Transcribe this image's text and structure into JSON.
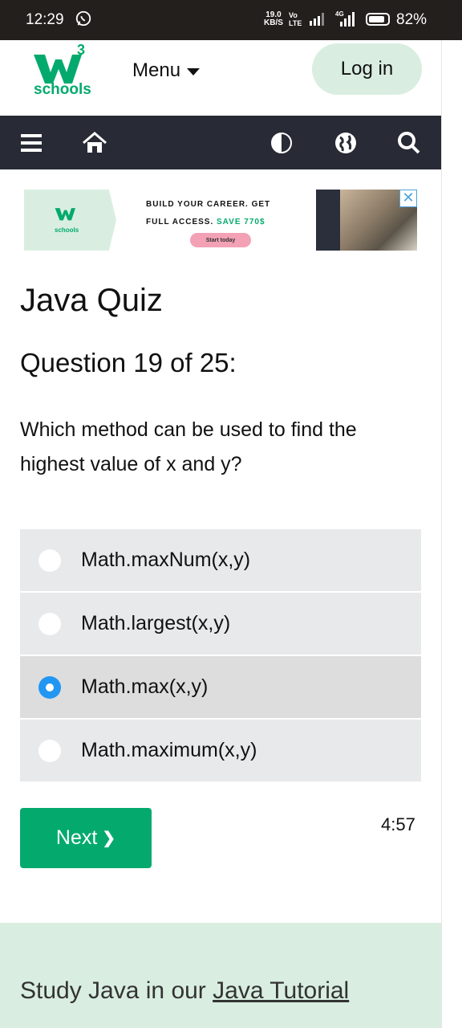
{
  "status_bar": {
    "time": "12:29",
    "net_speed_value": "19.0",
    "net_speed_unit": "KB/S",
    "volte_top": "Vo",
    "volte_bottom": "LTE",
    "network": "4G",
    "battery": "82%"
  },
  "header": {
    "logo_superscript": "3",
    "logo_text": "schools",
    "menu_label": "Menu",
    "login_label": "Log in"
  },
  "navbar": {
    "icons": [
      "menu-icon",
      "home-icon",
      "contrast-icon",
      "globe-icon",
      "search-icon"
    ]
  },
  "ad": {
    "logo_text": "schools",
    "line1": "BUILD YOUR CAREER. GET",
    "line2_prefix": "FULL ACCESS.",
    "line2_accent": "SAVE 770$",
    "cta": "Start today",
    "close": "✕"
  },
  "quiz": {
    "title": "Java Quiz",
    "question_count": "Question 19 of 25:",
    "question_text": "Which method can be used to find the highest value of x and y?",
    "options": [
      {
        "label": "Math.maxNum(x,y)",
        "selected": false
      },
      {
        "label": "Math.largest(x,y)",
        "selected": false
      },
      {
        "label": "Math.max(x,y)",
        "selected": true
      },
      {
        "label": "Math.maximum(x,y)",
        "selected": false
      }
    ],
    "next_label": "Next",
    "next_glyph": "❯",
    "timer": "4:57"
  },
  "footer": {
    "prefix": "Study Java in our ",
    "link": "Java Tutorial"
  },
  "colors": {
    "brand_green": "#04AA6D",
    "nav_dark": "#282a35",
    "light_green": "#d9eee1",
    "radio_blue": "#2196f3"
  }
}
